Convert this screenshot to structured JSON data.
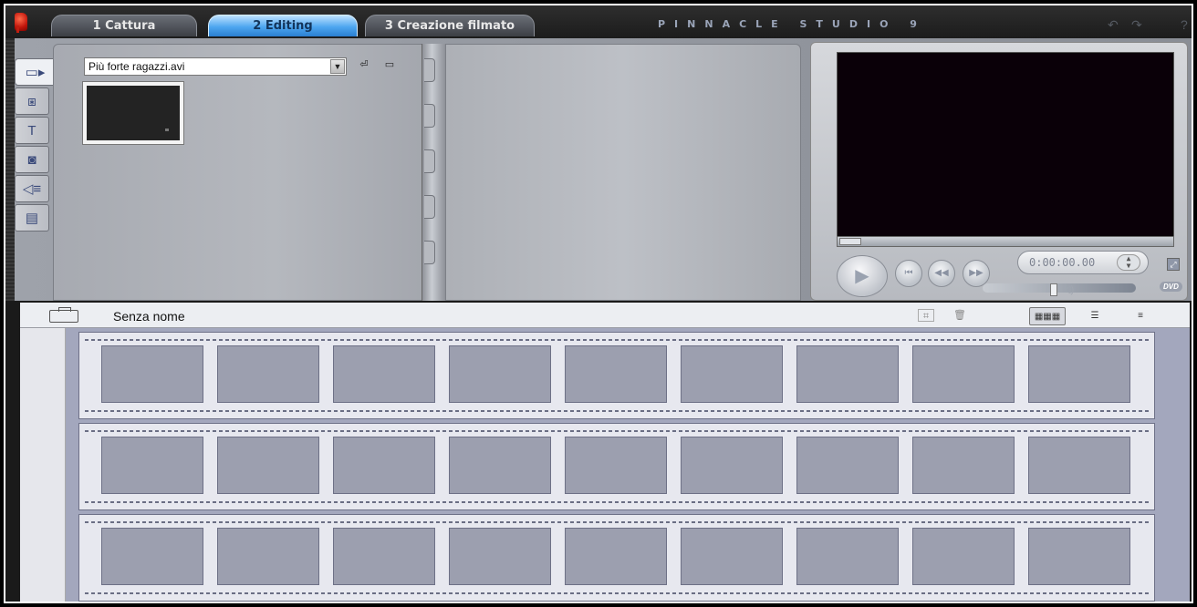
{
  "header": {
    "tabs": [
      {
        "label": "1 Cattura",
        "active": false
      },
      {
        "label": "2 Editing",
        "active": true
      },
      {
        "label": "3 Creazione filmato",
        "active": false
      }
    ],
    "brand": "PINNACLE STUDIO 9",
    "icons": [
      "undo-icon",
      "redo-icon",
      "help-icon"
    ]
  },
  "album": {
    "side_tabs": [
      {
        "icon": "video-camera-icon",
        "active": true
      },
      {
        "icon": "transitions-icon",
        "active": false
      },
      {
        "icon": "titles-icon",
        "active": false
      },
      {
        "icon": "still-photo-icon",
        "active": false
      },
      {
        "icon": "sound-effects-icon",
        "active": false
      },
      {
        "icon": "disc-menus-icon",
        "active": false
      }
    ],
    "source_file": "Più forte ragazzi.avi",
    "clips": 1
  },
  "player": {
    "timecode": "0:00:00.00",
    "dvd_label": "DVD",
    "controls": [
      "play-icon",
      "go-to-start-icon",
      "rewind-icon",
      "fast-forward-icon"
    ]
  },
  "movie": {
    "project_name": "Senza nome",
    "views": [
      "storyboard-view-icon",
      "timeline-view-icon",
      "text-view-icon"
    ],
    "active_view": "storyboard-view-icon",
    "storyboard_rows": 3,
    "cells_per_row": 9
  },
  "colors": {
    "active_tab": "#4da6f0",
    "player_screen": "#0a0008",
    "filmstrip_bg": "#a3a7bd"
  }
}
